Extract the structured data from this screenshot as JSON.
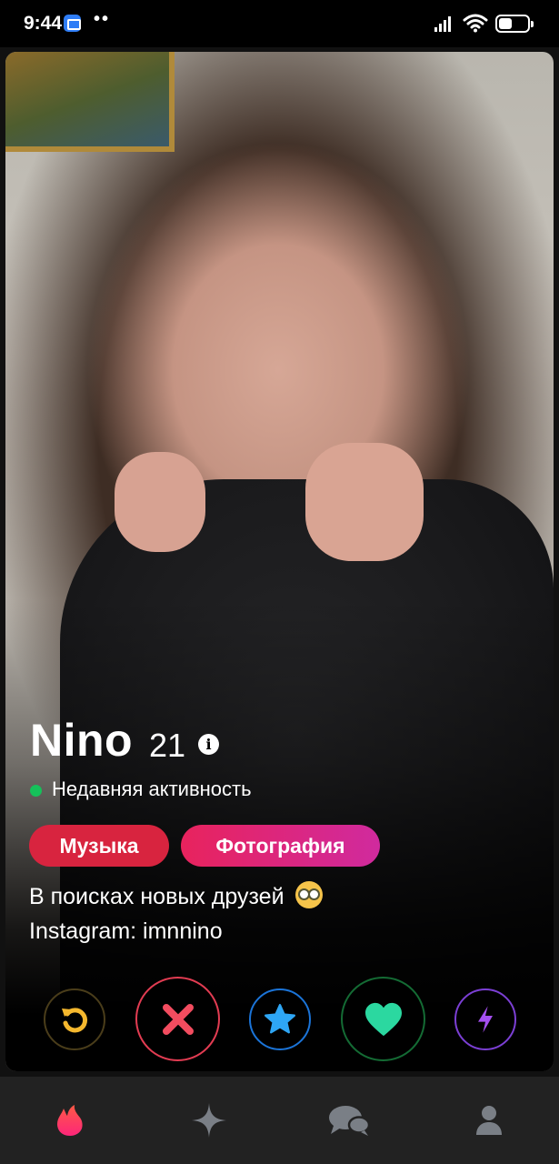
{
  "status_bar": {
    "time": "9:44",
    "dots": "••",
    "icons": [
      "message-app-icon",
      "signal-icon",
      "wifi-icon",
      "battery-icon"
    ]
  },
  "profile": {
    "name": "Nino",
    "age": "21",
    "info_icon": "info-icon",
    "activity": "Недавняя активность",
    "activity_color": "#16c15a",
    "interests": [
      "Музыка",
      "Фотография"
    ],
    "bio_line_1": "В поисках новых друзей",
    "bio_emoji": "nerd-face-emoji",
    "bio_line_2": "Instagram: imnnino"
  },
  "actions": [
    {
      "name": "rewind",
      "icon": "rewind-icon",
      "color": "#f5b82e"
    },
    {
      "name": "nope",
      "icon": "close-icon",
      "color": "#f24c5f"
    },
    {
      "name": "super-like",
      "icon": "star-icon",
      "color": "#2ea6f5"
    },
    {
      "name": "like",
      "icon": "heart-icon",
      "color": "#2bd8a0"
    },
    {
      "name": "boost",
      "icon": "lightning-icon",
      "color": "#a44ff0"
    }
  ],
  "bottom_nav": [
    {
      "name": "discover",
      "icon": "flame-icon",
      "active": true,
      "color": "#fd3a5c"
    },
    {
      "name": "explore",
      "icon": "sparkle-icon",
      "active": false,
      "color": "#7a7f86"
    },
    {
      "name": "chats",
      "icon": "chat-icon",
      "active": false,
      "color": "#7a7f86"
    },
    {
      "name": "profile",
      "icon": "user-icon",
      "active": false,
      "color": "#7a7f86"
    }
  ]
}
